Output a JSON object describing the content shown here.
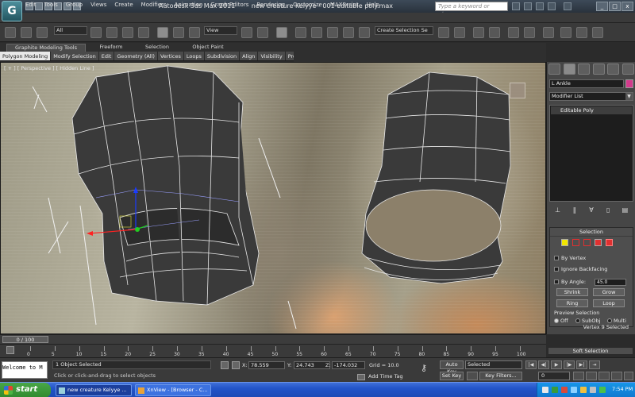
{
  "app": {
    "logo": "G",
    "title_app": "Autodesk 3ds Max  2011",
    "title_file": "new creature Kelyye - 001 editable poly.max",
    "search_placeholder": "Type a keyword or phrase",
    "win_controls": [
      "_",
      "□",
      "x"
    ]
  },
  "menu": [
    "Edit",
    "Tools",
    "Group",
    "Views",
    "Create",
    "Modifiers",
    "Animation",
    "Graph Editors",
    "Rendering",
    "Customize",
    "MAXScript",
    "Help"
  ],
  "toolbar": {
    "filter": "All",
    "refcoord": "View",
    "named_selection": "Create Selection Se"
  },
  "ribbon": {
    "tabs": [
      "Graphite Modeling Tools",
      "Freeform",
      "Selection",
      "Object Paint"
    ],
    "sub": [
      "Polygon Modeling",
      "Modify Selection",
      "Edit",
      "Geometry (All)",
      "Vertices",
      "Loops",
      "Subdivision",
      "Align",
      "Visibility",
      "Prop..."
    ]
  },
  "viewport": {
    "label": "[ + ] [ Perspective ] [ Hidden Line ]"
  },
  "command_panel": {
    "object_name": "L Ankle",
    "modifier_list": "Modifier List",
    "stack_item": "Editable Poly",
    "selection_title": "Selection",
    "by_vertex": "By Vertex",
    "ignore_backfacing": "Ignore Backfacing",
    "by_angle": "By Angle:",
    "angle_value": "45.0",
    "shrink": "Shrink",
    "grow": "Grow",
    "ring": "Ring",
    "loop": "Loop",
    "preview_title": "Preview Selection",
    "preview_off": "Off",
    "preview_subobj": "SubObj",
    "preview_multi": "Multi",
    "status": "Vertex 9 Selected",
    "soft_selection": "Soft Selection",
    "colors": {
      "object": "#d43a8c"
    }
  },
  "timeline": {
    "slider": "0 / 100",
    "ticks": [
      "0",
      "5",
      "10",
      "15",
      "20",
      "25",
      "30",
      "35",
      "40",
      "45",
      "50",
      "55",
      "60",
      "65",
      "70",
      "75",
      "80",
      "85",
      "90",
      "95",
      "100"
    ]
  },
  "status": {
    "listener": "Welcome to M",
    "selection_count": "1 Object Selected",
    "prompt": "Click or click-and-drag to select objects",
    "x_label": "X:",
    "x": "78.559",
    "y_label": "Y:",
    "y": "24.743",
    "z_label": "Z:",
    "z": "-174.032",
    "grid": "Grid = 10.0",
    "add_time_tag": "Add Time Tag",
    "auto_key": "Auto Key",
    "set_key": "Set Key",
    "selected": "Selected",
    "key_filters": "Key Filters...",
    "frame": "0"
  },
  "taskbar": {
    "start": "start",
    "tasks": [
      "new creature Kelyye ...",
      "XnView - [Browser - C..."
    ],
    "clock": "7:54 PM"
  }
}
